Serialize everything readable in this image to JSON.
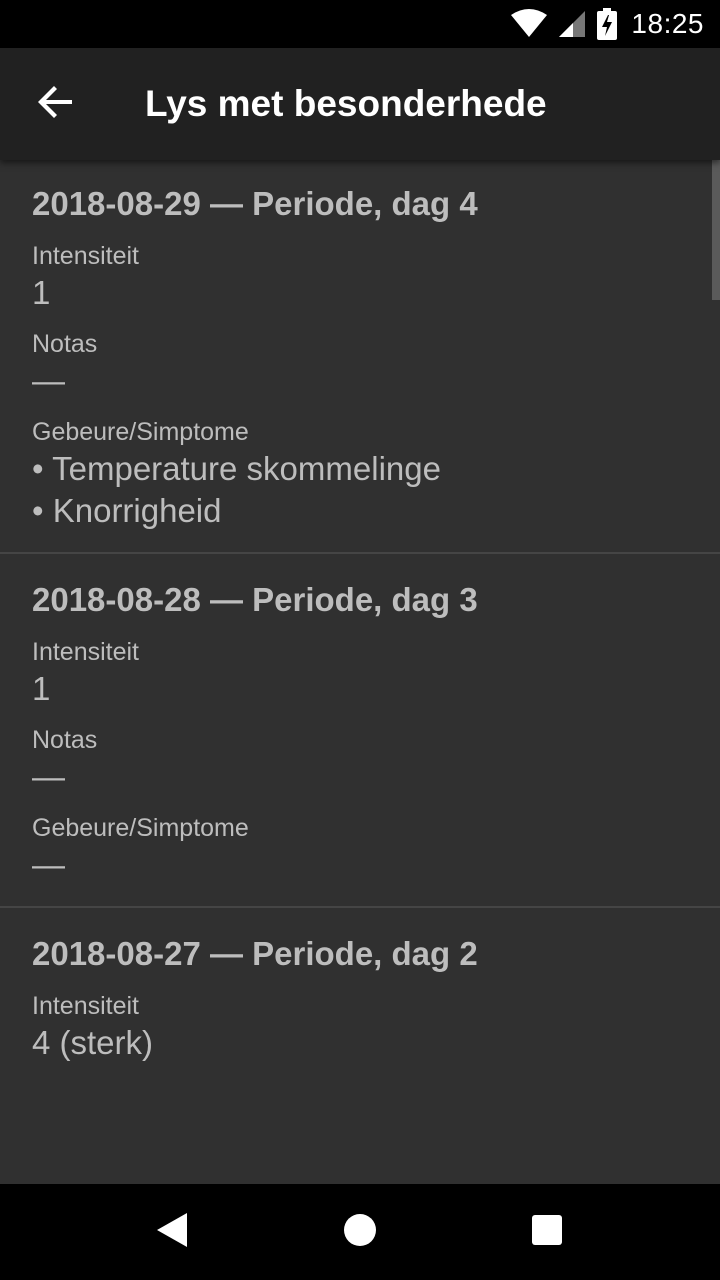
{
  "status_bar": {
    "time": "18:25",
    "icons": [
      "wifi-icon",
      "signal-icon",
      "battery-charging-icon"
    ]
  },
  "app_bar": {
    "back_icon": "arrow-left-icon",
    "title": "Lys met besonderhede"
  },
  "entries": [
    {
      "title": "2018-08-29 — Periode, dag 4",
      "intensity_label": "Intensiteit",
      "intensity_value": "1",
      "notes_label": "Notas",
      "notes_value": "—",
      "symptoms_label": "Gebeure/Simptome",
      "symptoms": [
        "• Temperature skommelinge",
        "• Knorrigheid"
      ]
    },
    {
      "title": "2018-08-28 — Periode, dag 3",
      "intensity_label": "Intensiteit",
      "intensity_value": "1",
      "notes_label": "Notas",
      "notes_value": "—",
      "symptoms_label": "Gebeure/Simptome",
      "symptoms": [
        "—"
      ]
    },
    {
      "title": "2018-08-27 — Periode, dag 2",
      "intensity_label": "Intensiteit",
      "intensity_value": "4 (sterk)"
    }
  ],
  "nav_bar": {
    "back_icon": "nav-back-triangle-icon",
    "home_icon": "nav-home-circle-icon",
    "recents_icon": "nav-recents-square-icon"
  },
  "colors": {
    "app_bar": "#212121",
    "content_bg": "#303030",
    "text_secondary": "#bdbdbd",
    "divider": "#454545"
  }
}
